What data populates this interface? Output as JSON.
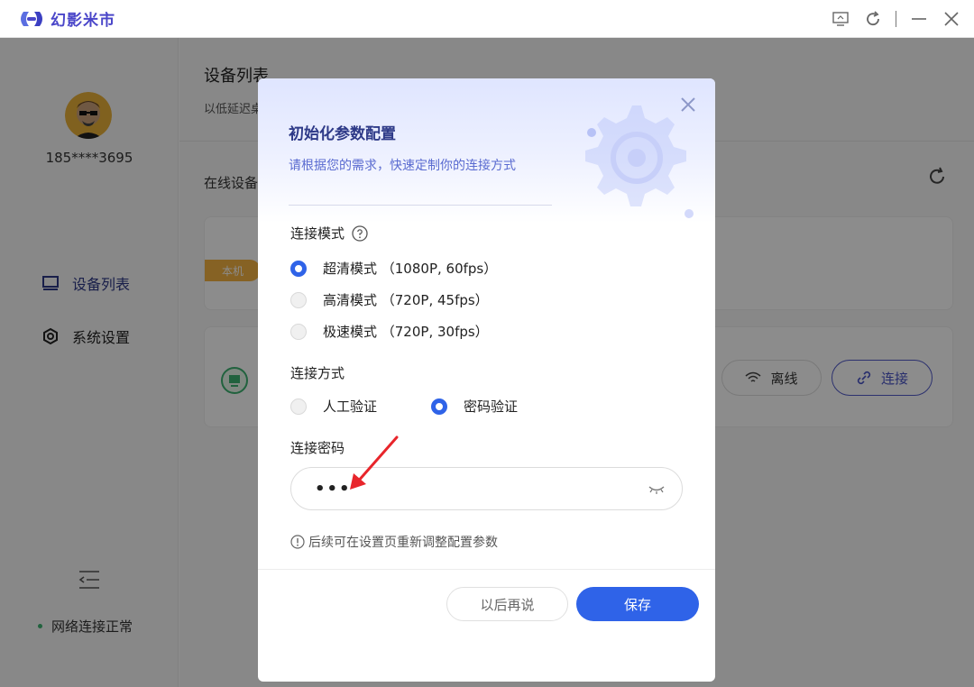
{
  "app": {
    "brand": "幻影米市"
  },
  "user": {
    "phone": "185****3695"
  },
  "sidebar": {
    "items": [
      {
        "label": "设备列表",
        "icon": "monitor-icon",
        "active": true
      },
      {
        "label": "系统设置",
        "icon": "settings-icon",
        "active": false
      }
    ],
    "network_status": "网络连接正常"
  },
  "main": {
    "title": "设备列表",
    "subtitle": "以低延迟桌",
    "online_label": "在线设备",
    "local_badge": "本机",
    "offline_label": "离线",
    "connect_label": "连接"
  },
  "modal": {
    "title": "初始化参数配置",
    "subtitle": "请根据您的需求，快速定制你的连接方式",
    "mode_label": "连接模式",
    "modes": [
      {
        "label": "超清模式 （1080P, 60fps）",
        "selected": true
      },
      {
        "label": "高清模式 （720P, 45fps）",
        "selected": false
      },
      {
        "label": "极速模式 （720P, 30fps）",
        "selected": false
      }
    ],
    "method_label": "连接方式",
    "methods": [
      {
        "label": "人工验证",
        "selected": false
      },
      {
        "label": "密码验证",
        "selected": true
      }
    ],
    "password_label": "连接密码",
    "password_value": "•••",
    "hint": "后续可在设置页重新调整配置参数",
    "later_button": "以后再说",
    "save_button": "保存"
  },
  "colors": {
    "primary": "#2f63e8",
    "brand": "#4a46c9",
    "badge": "#f5b342",
    "status_green": "#3cb371"
  }
}
